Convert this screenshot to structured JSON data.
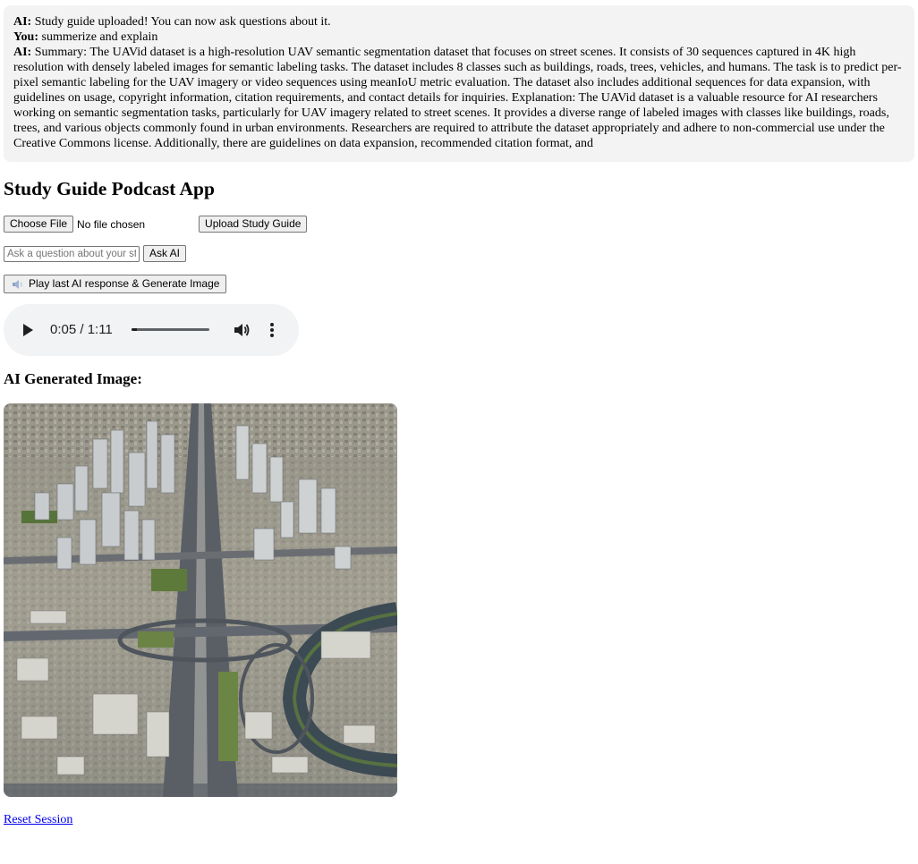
{
  "chat": {
    "messages": [
      {
        "speaker": "AI:",
        "text": " Study guide uploaded! You can now ask questions about it."
      },
      {
        "speaker": "You:",
        "text": " summerize and explain"
      },
      {
        "speaker": "AI:",
        "text": " Summary: The UAVid dataset is a high-resolution UAV semantic segmentation dataset that focuses on street scenes. It consists of 30 sequences captured in 4K high resolution with densely labeled images for semantic labeling tasks. The dataset includes 8 classes such as buildings, roads, trees, vehicles, and humans. The task is to predict per-pixel semantic labeling for the UAV imagery or video sequences using meanIoU metric evaluation. The dataset also includes additional sequences for data expansion, with guidelines on usage, copyright information, citation requirements, and contact details for inquiries. Explanation: The UAVid dataset is a valuable resource for AI researchers working on semantic segmentation tasks, particularly for UAV imagery related to street scenes. It provides a diverse range of labeled images with classes like buildings, roads, trees, and various objects commonly found in urban environments. Researchers are required to attribute the dataset appropriately and adhere to non-commercial use under the Creative Commons license. Additionally, there are guidelines on data expansion, recommended citation format, and"
      }
    ]
  },
  "app": {
    "title": "Study Guide Podcast App"
  },
  "upload": {
    "choose_file_label": "Choose File",
    "file_status": "No file chosen",
    "upload_label": "Upload Study Guide"
  },
  "ask": {
    "placeholder": "Ask a question about your study guide",
    "button_label": "Ask AI"
  },
  "play": {
    "button_label": "Play last AI response & Generate Image",
    "icon": "speaker-icon"
  },
  "audio": {
    "current_time": "0:05",
    "duration": "1:11",
    "time_display": "0:05 / 1:11",
    "progress": 0.07
  },
  "image_section": {
    "heading": "AI Generated Image:"
  },
  "reset": {
    "label": "Reset Session"
  }
}
